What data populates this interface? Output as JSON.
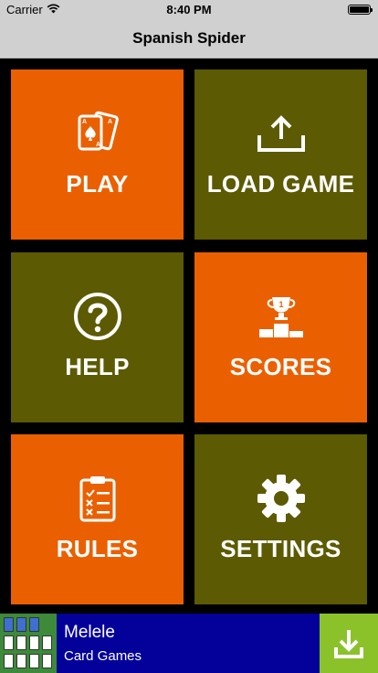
{
  "status_bar": {
    "carrier": "Carrier",
    "time": "8:40 PM"
  },
  "nav": {
    "title": "Spanish Spider"
  },
  "tiles": [
    {
      "label": "PLAY",
      "icon": "playing-cards-icon",
      "color": "#ea6000"
    },
    {
      "label": "LOAD GAME",
      "icon": "upload-icon",
      "color": "#5c5a02"
    },
    {
      "label": "HELP",
      "icon": "question-circle-icon",
      "color": "#5c5a02"
    },
    {
      "label": "SCORES",
      "icon": "trophy-podium-icon",
      "color": "#ea6000"
    },
    {
      "label": "RULES",
      "icon": "clipboard-checklist-icon",
      "color": "#ea6000"
    },
    {
      "label": "SETTINGS",
      "icon": "gear-icon",
      "color": "#5c5a02"
    }
  ],
  "ad": {
    "title": "Melele",
    "subtitle": "Card Games",
    "background": "#04009a",
    "button_color": "#8bc22a"
  }
}
